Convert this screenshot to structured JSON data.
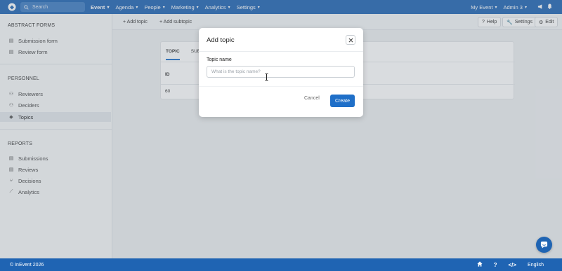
{
  "topbar": {
    "search_placeholder": "Search",
    "nav": [
      {
        "label": "Event",
        "bold": true
      },
      {
        "label": "Agenda"
      },
      {
        "label": "People"
      },
      {
        "label": "Marketing"
      },
      {
        "label": "Analytics"
      },
      {
        "label": "Settings"
      }
    ],
    "right": {
      "my_event": "My Event",
      "admin": "Admin 3"
    }
  },
  "sidebar": {
    "abstract_forms_title": "ABSTRACT FORMS",
    "submission_form": "Submission form",
    "review_form": "Review form",
    "personnel_title": "PERSONNEL",
    "reviewers": "Reviewers",
    "deciders": "Deciders",
    "topics": "Topics",
    "reports_title": "REPORTS",
    "submissions": "Submissions",
    "reviews": "Reviews",
    "decisions": "Decisions",
    "analytics": "Analytics"
  },
  "toolbar": {
    "add_topic": "+ Add topic",
    "add_subtopic": "+ Add subtopic",
    "help": "Help",
    "settings": "Settings",
    "edit": "Edit"
  },
  "card": {
    "tab_topic": "TOPIC",
    "tab_sub": "SUB",
    "col_id": "ID",
    "row_id": "60"
  },
  "modal": {
    "title": "Add topic",
    "field_label": "Topic name",
    "field_placeholder": "What is the topic name?",
    "cancel": "Cancel",
    "create": "Create"
  },
  "footer": {
    "copyright": "© InEvent 2026",
    "language": "English"
  },
  "colors": {
    "brand": "#1f64b3",
    "primary_button": "#1f6fc8"
  }
}
